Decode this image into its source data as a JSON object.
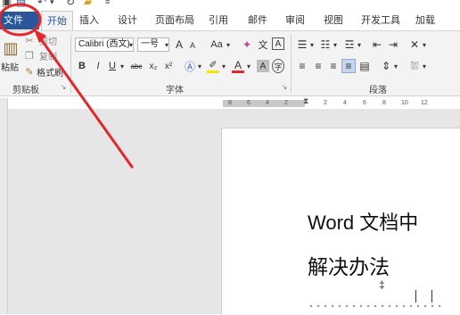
{
  "quick_access": {
    "icons": [
      "word-icon",
      "save-icon",
      "undo-icon",
      "redo-icon",
      "open-folder-icon",
      "customize-icon"
    ]
  },
  "tabs": {
    "file": "文件",
    "items": [
      "开始",
      "插入",
      "设计",
      "页面布局",
      "引用",
      "邮件",
      "审阅",
      "视图",
      "开发工具",
      "加载"
    ]
  },
  "clipboard": {
    "cut": "剪切",
    "copy": "复制",
    "paste": "粘贴",
    "format_painter": "格式刷",
    "group": "剪贴板"
  },
  "font": {
    "name": "Calibri (西文)",
    "size": "一号",
    "grow": "A",
    "shrink": "A",
    "case": "Aa",
    "bold": "B",
    "italic": "I",
    "underline": "U",
    "strike": "abc",
    "subscript": "x₂",
    "superscript": "x²",
    "phonetic": "文",
    "border_char": "A",
    "char_shading": "A",
    "enclose": "字",
    "group": "字体"
  },
  "paragraph": {
    "group": "段落"
  },
  "ruler": {
    "numbers": [
      "8",
      "6",
      "4",
      "2",
      "2",
      "4",
      "6",
      "8",
      "10",
      "12"
    ]
  },
  "document": {
    "line1": "Word 文档中",
    "line2": "解决办法",
    "mark": "‡"
  },
  "colors": {
    "file_tab": "#2a579a",
    "annotation": "#e5262a",
    "ribbon": "#f3f3f3",
    "workspace": "#e6e6e6"
  }
}
